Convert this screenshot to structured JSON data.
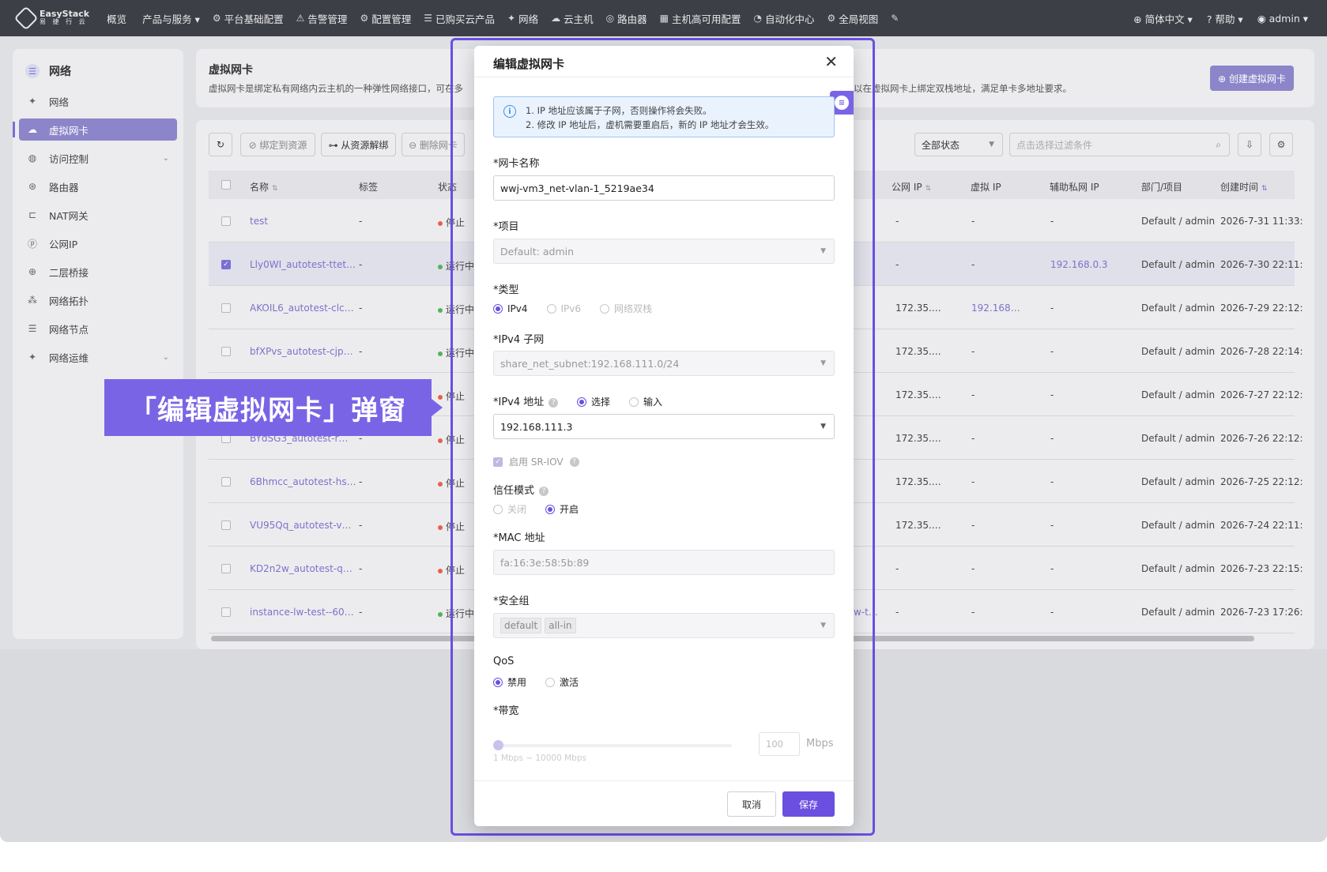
{
  "topbar": {
    "logo_main": "EasyStack",
    "logo_sub": "易 捷 行 云",
    "nav": [
      {
        "icon": "",
        "label": "概览"
      },
      {
        "icon": "",
        "label": "产品与服务 ▾"
      },
      {
        "icon": "⚙",
        "label": "平台基础配置"
      },
      {
        "icon": "⚠",
        "label": "告警管理"
      },
      {
        "icon": "⚙",
        "label": "配置管理"
      },
      {
        "icon": "☰",
        "label": "已购买云产品"
      },
      {
        "icon": "✦",
        "label": "网络"
      },
      {
        "icon": "☁",
        "label": "云主机"
      },
      {
        "icon": "◎",
        "label": "路由器"
      },
      {
        "icon": "▦",
        "label": "主机高可用配置"
      },
      {
        "icon": "◔",
        "label": "自动化中心"
      },
      {
        "icon": "⚙",
        "label": "全局视图"
      },
      {
        "icon": "✎",
        "label": ""
      }
    ],
    "lang": "简体中文 ▾",
    "help": "帮助 ▾",
    "user": "admin ▾"
  },
  "sidebar": {
    "title": "网络",
    "items": [
      {
        "icon": "✦",
        "label": "网络",
        "chev": ""
      },
      {
        "icon": "☁",
        "label": "虚拟网卡",
        "chev": ""
      },
      {
        "icon": "◍",
        "label": "访问控制",
        "chev": "⌄"
      },
      {
        "icon": "⊛",
        "label": "路由器",
        "chev": ""
      },
      {
        "icon": "⊏",
        "label": "NAT网关",
        "chev": ""
      },
      {
        "icon": "ⓟ",
        "label": "公网IP",
        "chev": ""
      },
      {
        "icon": "⊕",
        "label": "二层桥接",
        "chev": ""
      },
      {
        "icon": "⁂",
        "label": "网络拓扑",
        "chev": ""
      },
      {
        "icon": "☰",
        "label": "网络节点",
        "chev": ""
      },
      {
        "icon": "✦",
        "label": "网络运维",
        "chev": "⌄"
      }
    ]
  },
  "header": {
    "title": "虚拟网卡",
    "desc_left": "虚拟网卡是绑定私有网络内云主机的一种弹性网络接口，可在多",
    "desc_right": "以在虚拟网卡上绑定双栈地址，满足单卡多地址要求。",
    "create_label": "⊕ 创建虚拟网卡"
  },
  "toolbar": {
    "refresh": "↻",
    "bind": "⊘ 绑定到资源",
    "unbind": "⊶ 从资源解绑",
    "delete": "⊖ 删除网卡",
    "status_filter": "全部状态",
    "search_placeholder": "点击选择过滤条件",
    "export_icon": "⇩",
    "settings_icon": "⚙"
  },
  "table": {
    "headers": [
      "名称",
      "标签",
      "状态",
      "公网 IP",
      "虚拟 IP",
      "辅助私网 IP",
      "部门/项目",
      "创建时间"
    ],
    "rows": [
      {
        "name": "test",
        "tag": "-",
        "status": "停止",
        "status_color": "#e8604c",
        "public_ip": "-",
        "vip": "-",
        "secondary_ip": "-",
        "project": "Default / admin",
        "created": "2026-7-31 11:33:",
        "extra": ""
      },
      {
        "name": "Lly0WI_autotest-ttet…",
        "tag": "-",
        "status": "运行中",
        "status_color": "#52b35b",
        "public_ip": "-",
        "vip": "-",
        "secondary_ip": "192.168.0.3",
        "project": "Default / admin",
        "created": "2026-7-30 22:11:",
        "extra": ""
      },
      {
        "name": "AKOIL6_autotest-clc…",
        "tag": "-",
        "status": "运行中",
        "status_color": "#52b35b",
        "public_ip": "172.35.…",
        "vip": "192.168…",
        "secondary_ip": "-",
        "project": "Default / admin",
        "created": "2026-7-29 22:12:",
        "extra": ""
      },
      {
        "name": "bfXPvs_autotest-cjp…",
        "tag": "-",
        "status": "运行中",
        "status_color": "#52b35b",
        "public_ip": "172.35.…",
        "vip": "-",
        "secondary_ip": "-",
        "project": "Default / admin",
        "created": "2026-7-28 22:14:",
        "extra": ""
      },
      {
        "name": "",
        "tag": "",
        "status": "停止",
        "status_color": "#e8604c",
        "public_ip": "172.35.…",
        "vip": "-",
        "secondary_ip": "-",
        "project": "Default / admin",
        "created": "2026-7-27 22:12:",
        "extra": ""
      },
      {
        "name": "BYdSG3_autotest-r…",
        "tag": "-",
        "status": "停止",
        "status_color": "#e8604c",
        "public_ip": "172.35.…",
        "vip": "-",
        "secondary_ip": "-",
        "project": "Default / admin",
        "created": "2026-7-26 22:12:",
        "extra": ""
      },
      {
        "name": "6Bhmcc_autotest-hs…",
        "tag": "-",
        "status": "停止",
        "status_color": "#e8604c",
        "public_ip": "172.35.…",
        "vip": "-",
        "secondary_ip": "-",
        "project": "Default / admin",
        "created": "2026-7-25 22:12:",
        "extra": ""
      },
      {
        "name": "VU95Qq_autotest-v…",
        "tag": "-",
        "status": "停止",
        "status_color": "#e8604c",
        "public_ip": "172.35.…",
        "vip": "-",
        "secondary_ip": "-",
        "project": "Default / admin",
        "created": "2026-7-24 22:11:",
        "extra": ""
      },
      {
        "name": "KD2n2w_autotest-q…",
        "tag": "-",
        "status": "停止",
        "status_color": "#e8604c",
        "public_ip": "-",
        "vip": "-",
        "secondary_ip": "-",
        "project": "Default / admin",
        "created": "2026-7-23 22:15:",
        "extra": ""
      },
      {
        "name": "instance-lw-test--60…",
        "tag": "-",
        "status": "运行中",
        "status_color": "#52b35b",
        "public_ip": "-",
        "vip": "-",
        "secondary_ip": "-",
        "project": "Default / admin",
        "created": "2026-7-23 17:26:",
        "extra": "w-t…"
      }
    ]
  },
  "callout": {
    "text": "「编辑虚拟网卡」弹窗"
  },
  "modal": {
    "title": "编辑虚拟网卡",
    "close": "✕",
    "alert_lines": [
      "1. IP 地址应该属于子网，否则操作将会失败。",
      "2. 修改 IP 地址后，虚机需要重启后，新的 IP 地址才会生效。"
    ],
    "nic_name_label": "*网卡名称",
    "nic_name_value": "wwj-vm3_net-vlan-1_5219ae34",
    "project_label": "*项目",
    "project_value": "Default: admin",
    "type_label": "*类型",
    "type_options": [
      "IPv4",
      "IPv6",
      "网络双栈"
    ],
    "subnet_label": "*IPv4 子网",
    "subnet_value": "share_net_subnet:192.168.111.0/24",
    "ipv4_label": "*IPv4 地址",
    "ipv4_modes": [
      "选择",
      "输入"
    ],
    "ipv4_value": "192.168.111.3",
    "sriov_label": "启用 SR-IOV",
    "trust_label": "信任模式",
    "trust_options": [
      "关闭",
      "开启"
    ],
    "mac_label": "*MAC 地址",
    "mac_value": "fa:16:3e:58:5b:89",
    "sg_label": "*安全组",
    "sg_tags": [
      "default",
      "all-in"
    ],
    "qos_label": "QoS",
    "qos_options": [
      "禁用",
      "激活"
    ],
    "bw_label": "*带宽",
    "bw_value": "100",
    "bw_unit": "Mbps",
    "bw_hint": "1 Mbps ~ 10000 Mbps",
    "cancel": "取消",
    "save": "保存"
  },
  "colors": {
    "accent": "#6a4fe0",
    "callout": "#7a64e6",
    "topbar": "#3d3f46"
  }
}
